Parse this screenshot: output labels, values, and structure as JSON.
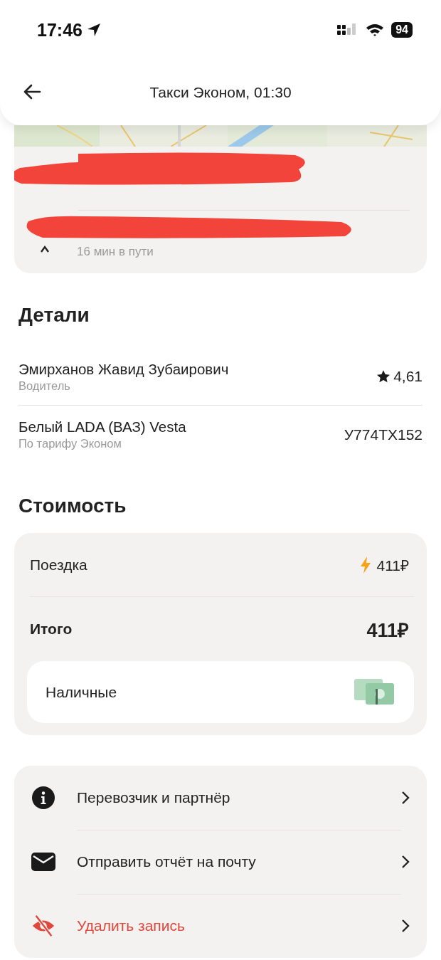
{
  "status_bar": {
    "time": "17:46",
    "battery": "94"
  },
  "header": {
    "title": "Такси Эконом, 01:30"
  },
  "route": {
    "duration": "16 мин в пути"
  },
  "details": {
    "heading": "Детали",
    "rows": [
      {
        "kind": "driver",
        "title": "Эмирханов Жавид Зубаирович",
        "subtitle": "Водитель",
        "value": "4,61"
      },
      {
        "kind": "car",
        "title": "Белый LADA (ВАЗ) Vesta",
        "subtitle": "По тарифу Эконом",
        "value": "У774ТХ152"
      }
    ]
  },
  "cost": {
    "heading": "Стоимость",
    "rows": [
      {
        "kind": "surge",
        "label": "Поездка",
        "amount": "411₽"
      },
      {
        "kind": "total",
        "label": "Итого",
        "amount": "411₽"
      }
    ],
    "payment": {
      "method": "Наличные"
    }
  },
  "actions": [
    {
      "kind": "info",
      "label": "Перевозчик и партнёр",
      "danger": false
    },
    {
      "kind": "mail",
      "label": "Отправить отчёт на почту",
      "danger": false
    },
    {
      "kind": "hide",
      "label": "Удалить запись",
      "danger": true
    }
  ]
}
